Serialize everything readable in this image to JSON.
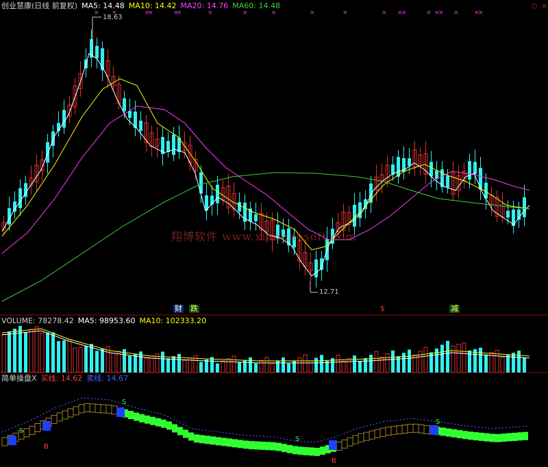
{
  "main_header": {
    "title": "创业慧康(日线 前复权)",
    "ma5": "MA5: 14.48",
    "ma10": "MA10: 14.42",
    "ma20": "MA20: 14.76",
    "ma60": "MA60: 14.48"
  },
  "volume_header": {
    "title": "VOLUME: 78278.42",
    "ma5": "MA5: 98953.60",
    "ma10": "MA10: 102333.20"
  },
  "indicator_header": {
    "title": "简单操盘X",
    "buy": "买线: 14.62",
    "sell": "卖线: 14.67"
  },
  "annotations": {
    "high": "18.63",
    "low": "12.71",
    "flag_cai": "财",
    "flag_die": "跌",
    "flag_dollar": "$",
    "flag_jian": "减"
  },
  "watermark": "翔博软件 www.xiangbosoft.com",
  "corner_icons": [
    "◇",
    "×"
  ],
  "colors": {
    "up": "#e03030",
    "down": "#30f0f0",
    "ma5": "#ffffff",
    "ma10": "#ffff00",
    "ma20": "#ff40ff",
    "ma60": "#40d040",
    "buy": "#ff4040",
    "sell": "#4060ff",
    "green_band": "#30ff30",
    "blue_block": "#2040ff"
  },
  "chart_data": {
    "type": "candlestick",
    "price_range": [
      12.71,
      18.63
    ],
    "ma_latest": {
      "MA5": 14.48,
      "MA10": 14.42,
      "MA20": 14.76,
      "MA60": 14.48
    },
    "volume_latest": {
      "VOLUME": 78278.42,
      "MA5": 98953.6,
      "MA10": 102333.2
    },
    "indicator_latest": {
      "买线": 14.62,
      "卖线": 14.67
    },
    "signals": [
      "S",
      "B"
    ]
  }
}
